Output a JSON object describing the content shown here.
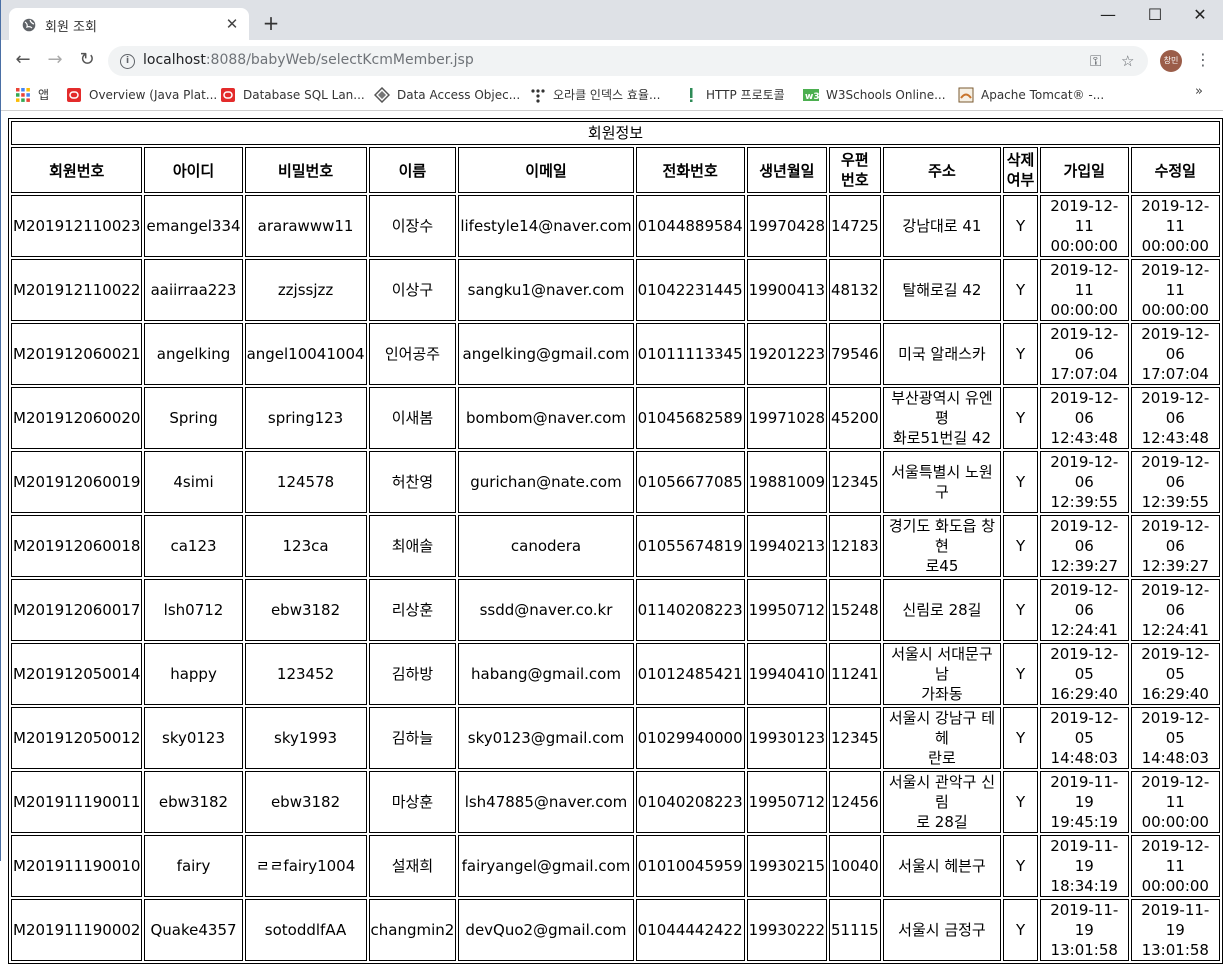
{
  "browser": {
    "tab_title": "회원 조회",
    "url_host": "localhost",
    "url_rest": ":8088/babyWeb/selectKcmMember.jsp",
    "avatar_text": "창민",
    "bookmarks": [
      {
        "label": "앱",
        "icon": "apps-grid-icon"
      },
      {
        "label": "Overview (Java Plat...",
        "icon": "oracle-icon"
      },
      {
        "label": "Database SQL Lan...",
        "icon": "oracle-icon"
      },
      {
        "label": "Data Access Objec...",
        "icon": "diamond-icon"
      },
      {
        "label": "오라클 인덱스 효율...",
        "icon": "dots-icon"
      },
      {
        "label": "HTTP 프로토콜",
        "icon": "exclamation-icon"
      },
      {
        "label": "W3Schools Online...",
        "icon": "w3schools-icon"
      },
      {
        "label": "Apache Tomcat® -...",
        "icon": "tomcat-icon"
      }
    ],
    "more_bookmarks": "»"
  },
  "table": {
    "caption": "회원정보",
    "headers": [
      "회원번호",
      "아이디",
      "비밀번호",
      "이름",
      "이메일",
      "전화번호",
      "생년월일",
      "우편번호",
      "주소",
      "삭제여부",
      "가입일",
      "수정일"
    ],
    "header_display": [
      "회원번호",
      "아이디",
      "비밀번호",
      "이름",
      "이메일",
      "전화번호",
      "생년월일",
      "우편\n번호",
      "주소",
      "삭제\n여부",
      "가입일",
      "수정일"
    ],
    "rows": [
      [
        "M201912110023",
        "emangel334",
        "ararawww11",
        "이장수",
        "lifestyle14@naver.com",
        "01044889584",
        "19970428",
        "14725",
        "강남대로 41",
        "Y",
        "2019-12-11\n00:00:00",
        "2019-12-11\n00:00:00"
      ],
      [
        "M201912110022",
        "aaiirraa223",
        "zzjssjzz",
        "이상구",
        "sangku1@naver.com",
        "01042231445",
        "19900413",
        "48132",
        "탈해로길 42",
        "Y",
        "2019-12-11\n00:00:00",
        "2019-12-11\n00:00:00"
      ],
      [
        "M201912060021",
        "angelking",
        "angel10041004",
        "인어공주",
        "angelking@gmail.com",
        "01011113345",
        "19201223",
        "79546",
        "미국 알래스카",
        "Y",
        "2019-12-06\n17:07:04",
        "2019-12-06\n17:07:04"
      ],
      [
        "M201912060020",
        "Spring",
        "spring123",
        "이새봄",
        "bombom@naver.com",
        "01045682589",
        "19971028",
        "45200",
        "부산광역시 유엔평\n화로51번길 42",
        "Y",
        "2019-12-06\n12:43:48",
        "2019-12-06\n12:43:48"
      ],
      [
        "M201912060019",
        "4simi",
        "124578",
        "허찬영",
        "gurichan@nate.com",
        "01056677085",
        "19881009",
        "12345",
        "서울특별시 노원구",
        "Y",
        "2019-12-06\n12:39:55",
        "2019-12-06\n12:39:55"
      ],
      [
        "M201912060018",
        "ca123",
        "123ca",
        "최애솔",
        "canodera",
        "01055674819",
        "19940213",
        "12183",
        "경기도 화도읍 창현\n로45",
        "Y",
        "2019-12-06\n12:39:27",
        "2019-12-06\n12:39:27"
      ],
      [
        "M201912060017",
        "lsh0712",
        "ebw3182",
        "리상훈",
        "ssdd@naver.co.kr",
        "01140208223",
        "19950712",
        "15248",
        "신림로 28길",
        "Y",
        "2019-12-06\n12:24:41",
        "2019-12-06\n12:24:41"
      ],
      [
        "M201912050014",
        "happy",
        "123452",
        "김하방",
        "habang@gmail.com",
        "01012485421",
        "19940410",
        "11241",
        "서울시 서대문구 남\n가좌동",
        "Y",
        "2019-12-05\n16:29:40",
        "2019-12-05\n16:29:40"
      ],
      [
        "M201912050012",
        "sky0123",
        "sky1993",
        "김하늘",
        "sky0123@gmail.com",
        "01029940000",
        "19930123",
        "12345",
        "서울시 강남구 테헤\n란로",
        "Y",
        "2019-12-05\n14:48:03",
        "2019-12-05\n14:48:03"
      ],
      [
        "M201911190011",
        "ebw3182",
        "ebw3182",
        "마상훈",
        "lsh47885@naver.com",
        "01040208223",
        "19950712",
        "12456",
        "서울시 관악구 신림\n로 28길",
        "Y",
        "2019-11-19\n19:45:19",
        "2019-12-11\n00:00:00"
      ],
      [
        "M201911190010",
        "fairy",
        "ㄹㄹfairy1004",
        "설재희",
        "fairyangel@gmail.com",
        "01010045959",
        "19930215",
        "10040",
        "서울시 헤븐구",
        "Y",
        "2019-11-19\n18:34:19",
        "2019-12-11\n00:00:00"
      ],
      [
        "M201911190002",
        "Quake4357",
        "sotoddlfAA",
        "changmin2",
        "devQuo2@gmail.com",
        "01044442422",
        "19930222",
        "51115",
        "서울시 금정구",
        "Y",
        "2019-11-19\n13:01:58",
        "2019-11-19\n13:01:58"
      ]
    ]
  }
}
